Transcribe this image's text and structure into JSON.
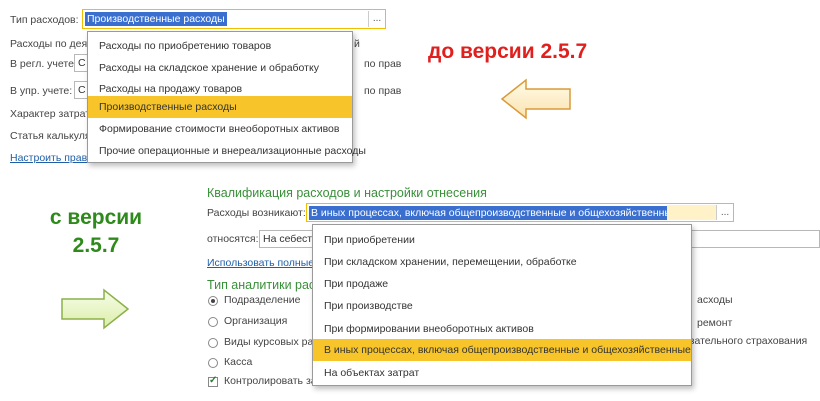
{
  "top_form": {
    "rows": [
      {
        "label": "Тип расходов:"
      },
      {
        "label": "Расходы по дея"
      },
      {
        "label": "В регл. учете:"
      },
      {
        "label": "В упр. учете:"
      },
      {
        "label": "Характер затрат:"
      },
      {
        "label": "Статья калькуля"
      }
    ],
    "field_value": "Производственные расходы",
    "dots": "...",
    "row2_fragment": "С",
    "row3_fragment": "С",
    "right_fragment_1": "й",
    "right_fragment_2": "по прав",
    "right_fragment_3": "по прав",
    "link": "Настроить прави",
    "dropdown": [
      "Расходы по приобретению товаров",
      "Расходы на складское хранение и обработку",
      "Расходы на продажу товаров",
      "Производственные расходы",
      "Формирование стоимости внеоборотных активов",
      "Прочие операционные и внереализационные расходы"
    ],
    "dropdown_active_index": 3
  },
  "labels": {
    "before": "до версии 2.5.7",
    "since_line1": "с версии",
    "since_line2": "2.5.7"
  },
  "bottom_form": {
    "section_title": "Квалификация расходов и настройки отнесения",
    "arise_label": "Расходы возникают:",
    "arise_value": "В иных процессах, включая общепроизводственные и общехозяйственные",
    "dots": "...",
    "relate_label": "относятся:",
    "relate_value": "На себест",
    "link": "Использовать полные",
    "analytics_title": "Тип аналитики расх",
    "radios": [
      {
        "label": "Подразделение",
        "checked": true
      },
      {
        "label": "Организация",
        "checked": false
      },
      {
        "label": "Виды курсовых раз",
        "checked": false
      },
      {
        "label": "Касса",
        "checked": false
      }
    ],
    "checkbox": {
      "label": "Контролировать за",
      "checked": true
    },
    "right_fragments": [
      "асходы",
      "ремонт",
      "язательного страхования"
    ],
    "dropdown": [
      "При приобретении",
      "При складском хранении, перемещении, обработке",
      "При продаже",
      "При производстве",
      "При формировании внеоборотных активов",
      "В иных процессах, включая общепроизводственные и общехозяйственные",
      "На объектах затрат"
    ],
    "dropdown_active_index": 5
  },
  "colors": {
    "red_label": "#e0201e",
    "green_label": "#2e8a1a",
    "highlight": "#f7c52a",
    "selection": "#3a6fd0",
    "section_green": "#3a8f3a"
  }
}
